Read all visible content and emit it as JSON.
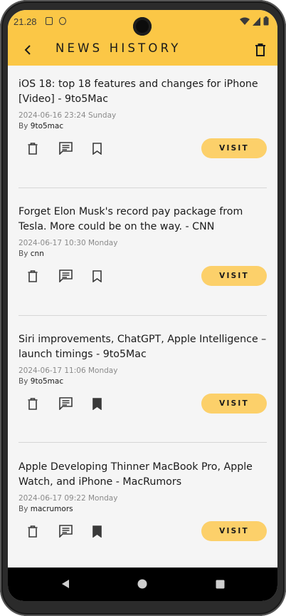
{
  "status_bar": {
    "time": "21.28"
  },
  "app_bar": {
    "title": "NEWS HISTORY"
  },
  "articles": [
    {
      "title": "iOS 18: top 18 features and changes for iPhone [Video] - 9to5Mac",
      "date": "2024-06-16 23:24 Sunday",
      "by_prefix": "By",
      "source": "9to5mac",
      "visit_label": "VISIT",
      "bookmarked": false
    },
    {
      "title": "Forget Elon Musk's record pay package from Tesla. More could be on the way. - CNN",
      "date": "2024-06-17 10:30 Monday",
      "by_prefix": "By",
      "source": "cnn",
      "visit_label": "VISIT",
      "bookmarked": false
    },
    {
      "title": "Siri improvements, ChatGPT, Apple Intelligence – launch timings - 9to5Mac",
      "date": "2024-06-17 11:06 Monday",
      "by_prefix": "By",
      "source": "9to5mac",
      "visit_label": "VISIT",
      "bookmarked": true
    },
    {
      "title": "Apple Developing Thinner MacBook Pro, Apple Watch, and iPhone - MacRumors",
      "date": "2024-06-17 09:22 Monday",
      "by_prefix": "By",
      "source": "macrumors",
      "visit_label": "VISIT",
      "bookmarked": true
    }
  ],
  "icons": {
    "back": "arrow-left-icon",
    "delete_all": "trash-icon",
    "delete": "trash-icon",
    "comment": "comment-icon",
    "bookmark": "bookmark-icon"
  },
  "colors": {
    "accent": "#fbc746",
    "button": "#fcd06a",
    "background": "#f5f5f5"
  }
}
